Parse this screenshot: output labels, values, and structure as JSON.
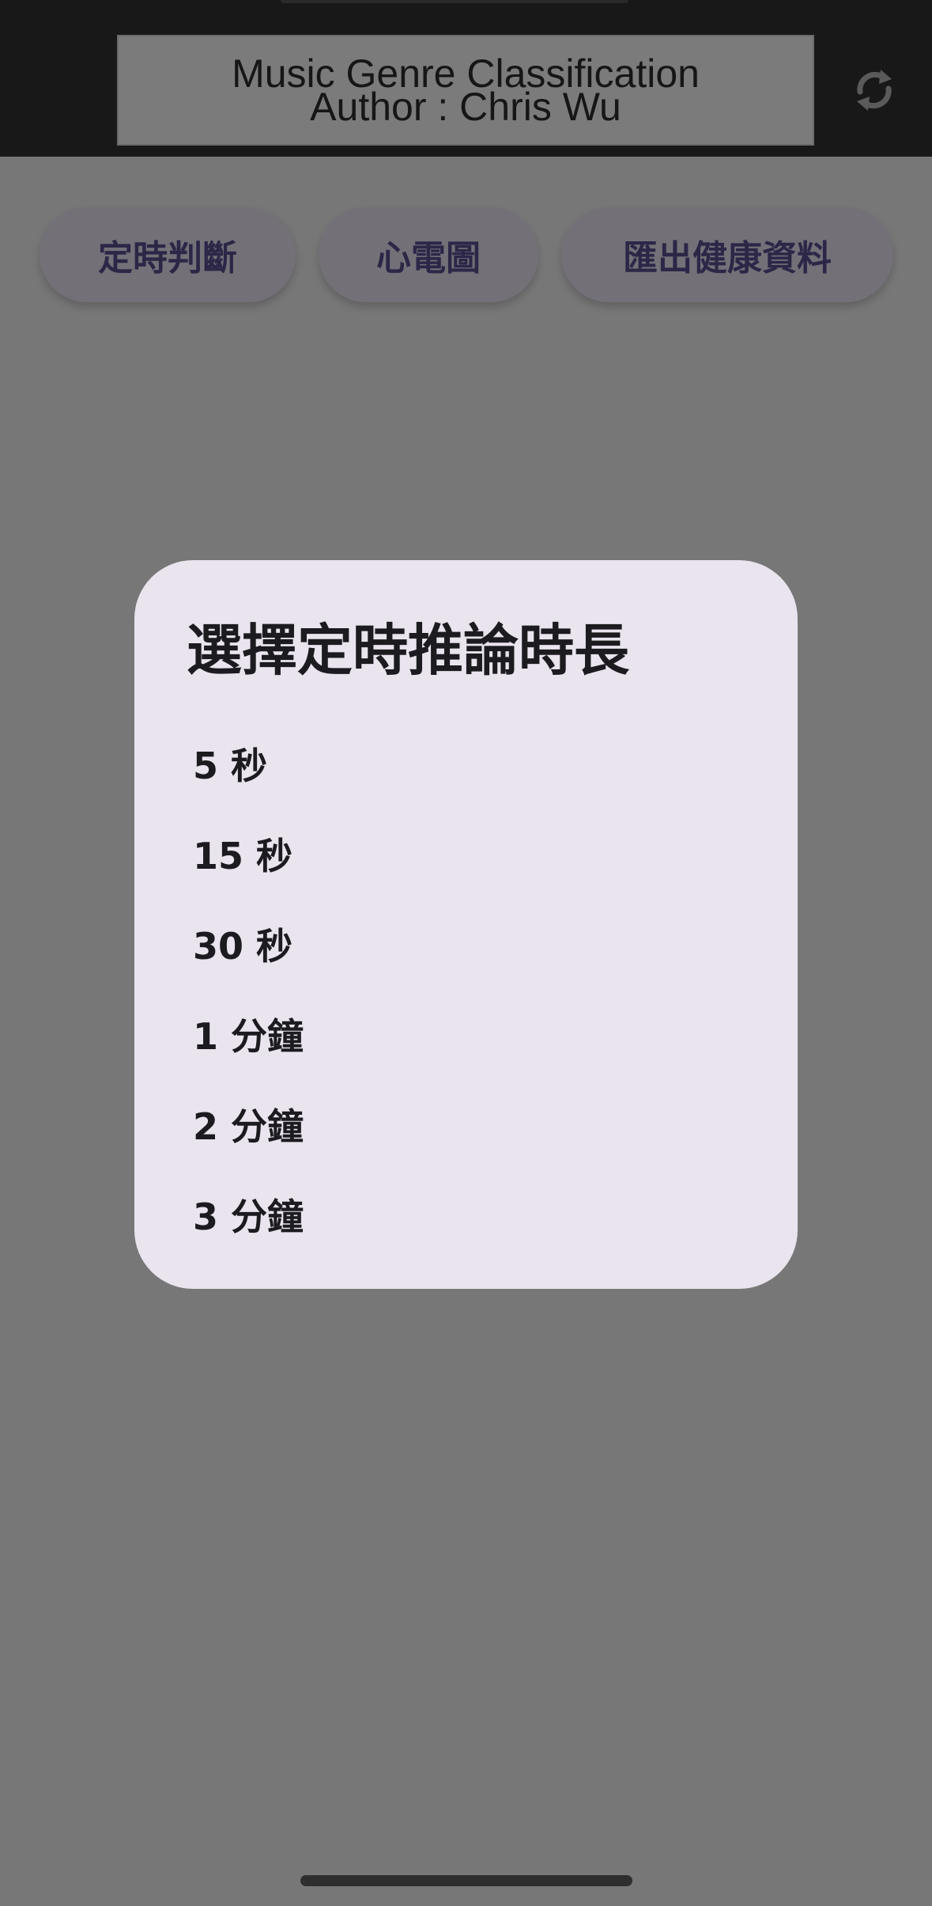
{
  "header": {
    "title_line1": "Music Genre Classification",
    "title_line2": "Author : Chris Wu",
    "refresh_icon": "refresh-icon"
  },
  "tabs": [
    {
      "label": "定時判斷"
    },
    {
      "label": "心電圖"
    },
    {
      "label": "匯出健康資料"
    }
  ],
  "dialog": {
    "title": "選擇定時推論時長",
    "options": [
      {
        "label": "5 秒"
      },
      {
        "label": "15 秒"
      },
      {
        "label": "30 秒"
      },
      {
        "label": "1 分鐘"
      },
      {
        "label": "2 分鐘"
      },
      {
        "label": "3 分鐘"
      }
    ]
  },
  "colors": {
    "scrim": "#777777",
    "app_bar": "#181818",
    "dialog_bg": "#e9e4ee",
    "tab_text": "#2c2747",
    "text_dark": "#1c1b20"
  }
}
